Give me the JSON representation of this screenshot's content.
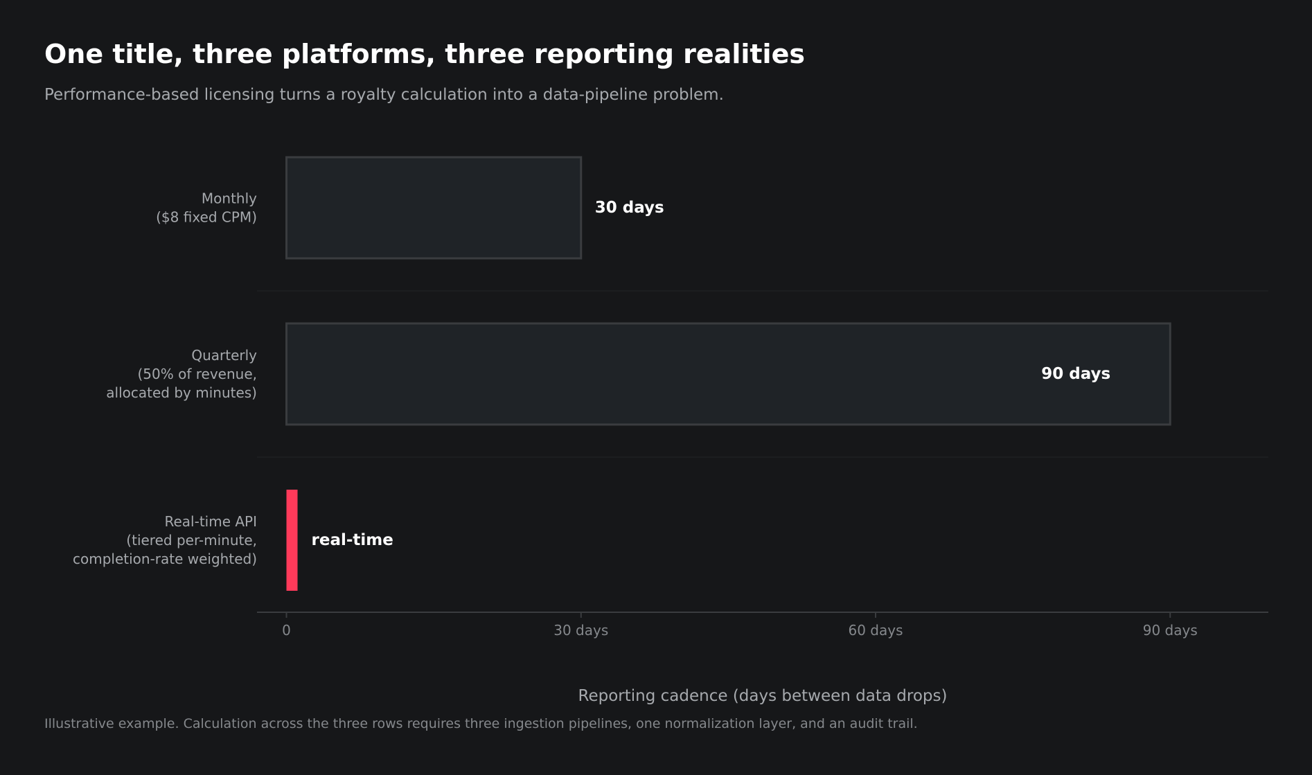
{
  "title": "One title, three platforms, three reporting realities",
  "subtitle": "Performance-based licensing turns a royalty calculation into a data-pipeline problem.",
  "footnote": "Illustrative example. Calculation across the three rows requires three ingestion pipelines, one normalization layer, and an audit trail.",
  "chart_data": {
    "type": "bar",
    "orientation": "horizontal",
    "categories": [
      [
        "Monthly",
        "($8 fixed CPM)"
      ],
      [
        "Quarterly",
        "(50% of revenue,",
        "allocated by minutes)"
      ],
      [
        "Real-time API",
        "(tiered per-minute,",
        "completion-rate weighted)"
      ]
    ],
    "values": [
      30,
      90,
      0
    ],
    "data_labels": [
      "30 days",
      "90 days",
      "real-time"
    ],
    "xlabel": "Reporting cadence (days between data drops)",
    "xticks": [
      0,
      30,
      60,
      90
    ],
    "xtick_labels": [
      "0",
      "30 days",
      "60 days",
      "90 days"
    ],
    "xlim": [
      -3,
      100
    ],
    "grid": false,
    "colors": {
      "bar_fill": "#1f2327",
      "bar_stroke": "#3a3c3f",
      "highlight": "#ff3a5a",
      "value_label": "#ffffff",
      "category_label": "#a6a9ad",
      "tick_label": "#85888c",
      "axis": "#3a3c3f",
      "separator": "#222427"
    }
  }
}
